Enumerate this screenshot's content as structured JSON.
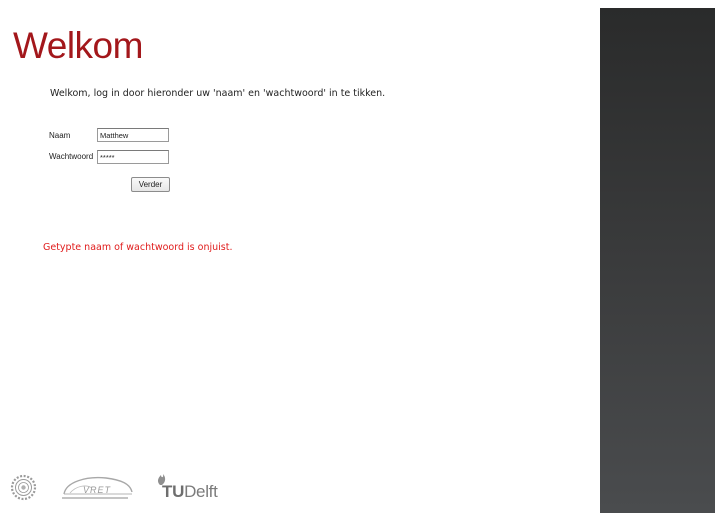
{
  "page": {
    "title": "Welkom",
    "intro": "Welkom, log in door hieronder uw 'naam' en 'wachtwoord' in te tikken.",
    "error_message": "Getypte naam of wachtwoord is onjuist."
  },
  "form": {
    "name_label": "Naam",
    "name_value": "Matthew",
    "password_label": "Wachtwoord",
    "password_value": "*****",
    "submit_label": "Verder"
  },
  "logos": [
    {
      "name": "university-seal",
      "icon": "seal-logo"
    },
    {
      "name": "vret",
      "text": "VRET"
    },
    {
      "name": "tudelft",
      "text_bold": "TU",
      "text_regular": "Delft"
    }
  ],
  "colors": {
    "title": "#a3171b",
    "error": "#e01c1c",
    "sidepanel_top": "#2a2b2b",
    "sidepanel_bottom": "#4a4c4e"
  }
}
